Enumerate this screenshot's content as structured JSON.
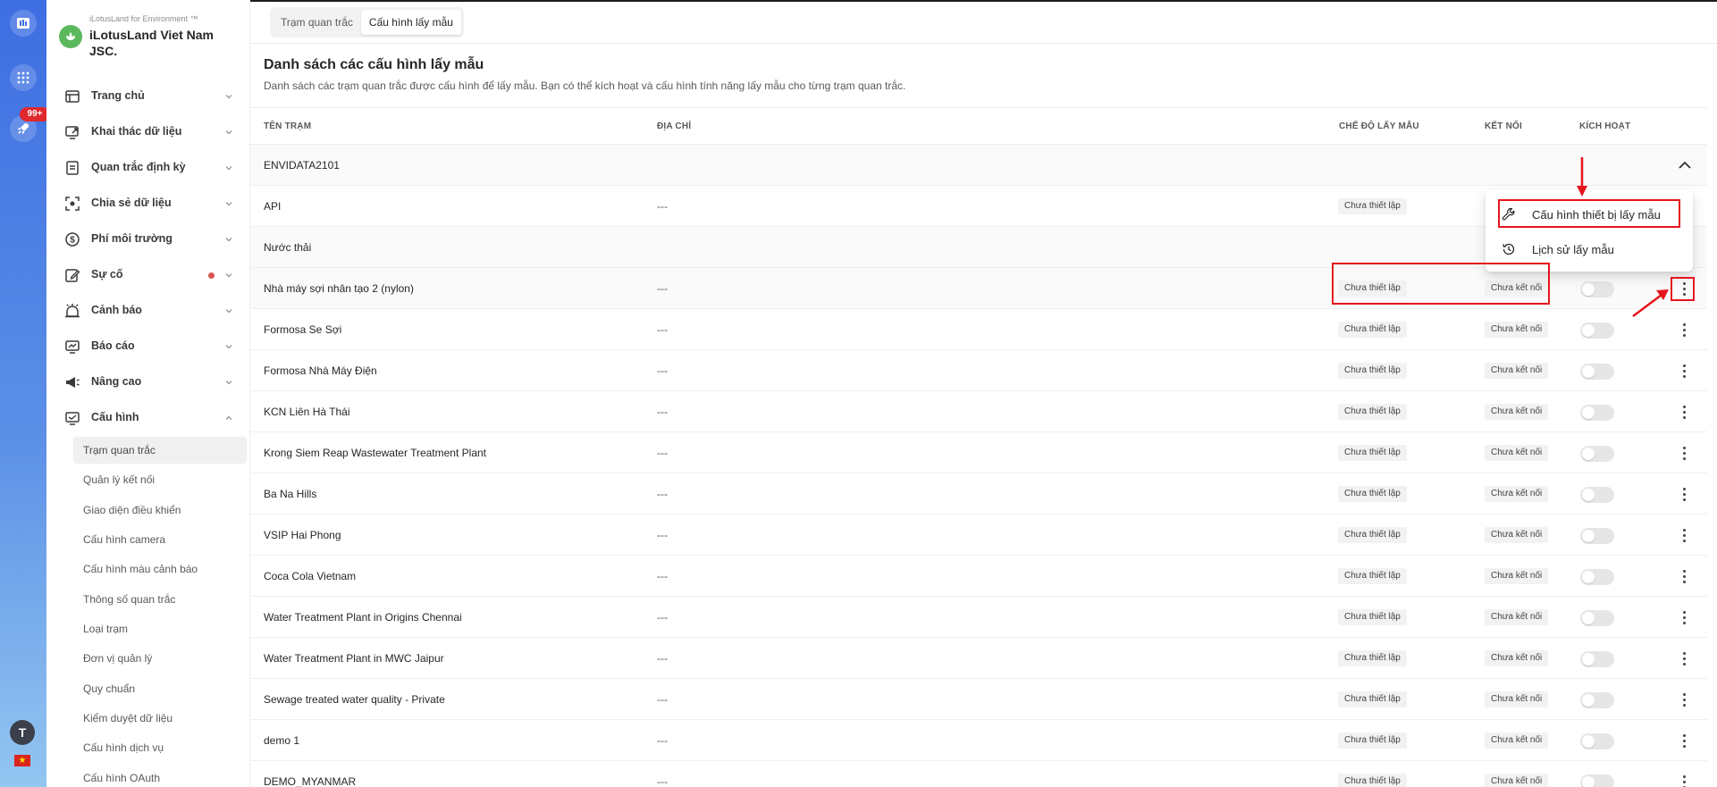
{
  "brand": {
    "subtitle": "iLotusLand for Environment ™",
    "name": "iLotusLand Viet Nam JSC."
  },
  "rail": {
    "notification_count": "99+",
    "user_initial": "T"
  },
  "nav": [
    {
      "label": "Trang chủ"
    },
    {
      "label": "Khai thác dữ liệu"
    },
    {
      "label": "Quan trắc định kỳ"
    },
    {
      "label": "Chia sẻ dữ liệu"
    },
    {
      "label": "Phí môi trường"
    },
    {
      "label": "Sự cố"
    },
    {
      "label": "Cảnh báo"
    },
    {
      "label": "Báo cáo"
    },
    {
      "label": "Nâng cao"
    },
    {
      "label": "Cấu hình"
    }
  ],
  "config_submenu": [
    "Trạm quan trắc",
    "Quản lý kết nối",
    "Giao diện điều khiển",
    "Cấu hình camera",
    "Cấu hình màu cảnh báo",
    "Thông số quan trắc",
    "Loại trạm",
    "Đơn vị quản lý",
    "Quy chuẩn",
    "Kiểm duyệt dữ liệu",
    "Cấu hình dịch vụ",
    "Cấu hình OAuth"
  ],
  "tabs": [
    "Trạm quan trắc",
    "Cấu hình lấy mẫu"
  ],
  "page": {
    "title": "Danh sách các cấu hình lấy mẫu",
    "description": "Danh sách các trạm quan trắc được cấu hình để lấy mẫu. Bạn có thể kích hoạt và cấu hình tính năng lấy mẫu cho từng trạm quan trắc."
  },
  "table": {
    "headers": {
      "name": "TÊN TRẠM",
      "address": "ĐỊA CHỈ",
      "mode": "CHẾ ĐỘ LẤY MẪU",
      "connection": "KẾT NỐI",
      "active": "KÍCH HOẠT"
    },
    "rows": [
      {
        "type": "group",
        "name": "ENVIDATA2101"
      },
      {
        "type": "station",
        "name": "API",
        "address": "---",
        "mode": "Chưa thiết lập"
      },
      {
        "type": "group",
        "name": "Nước thải"
      },
      {
        "type": "station",
        "name": "Nhà máy sợi nhân tạo 2 (nylon)",
        "address": "---",
        "mode": "Chưa thiết lập",
        "connection": "Chưa kết nối"
      },
      {
        "type": "station",
        "name": "Formosa Se Sợi",
        "address": "---",
        "mode": "Chưa thiết lập",
        "connection": "Chưa kết nối"
      },
      {
        "type": "station",
        "name": "Formosa Nhà Máy Điện",
        "address": "---",
        "mode": "Chưa thiết lập",
        "connection": "Chưa kết nối"
      },
      {
        "type": "station",
        "name": "KCN Liên Hà Thái",
        "address": "---",
        "mode": "Chưa thiết lập",
        "connection": "Chưa kết nối"
      },
      {
        "type": "station",
        "name": "Krong Siem Reap Wastewater Treatment Plant",
        "address": "---",
        "mode": "Chưa thiết lập",
        "connection": "Chưa kết nối"
      },
      {
        "type": "station",
        "name": "Ba Na Hills",
        "address": "---",
        "mode": "Chưa thiết lập",
        "connection": "Chưa kết nối"
      },
      {
        "type": "station",
        "name": "VSIP Hai Phong",
        "address": "---",
        "mode": "Chưa thiết lập",
        "connection": "Chưa kết nối"
      },
      {
        "type": "station",
        "name": "Coca Cola Vietnam",
        "address": "---",
        "mode": "Chưa thiết lập",
        "connection": "Chưa kết nối"
      },
      {
        "type": "station",
        "name": "Water Treatment Plant in Origins Chennai",
        "address": "---",
        "mode": "Chưa thiết lập",
        "connection": "Chưa kết nối"
      },
      {
        "type": "station",
        "name": "Water Treatment Plant in MWC Jaipur",
        "address": "---",
        "mode": "Chưa thiết lập",
        "connection": "Chưa kết nối"
      },
      {
        "type": "station",
        "name": "Sewage treated water quality - Private",
        "address": "---",
        "mode": "Chưa thiết lập",
        "connection": "Chưa kết nối"
      },
      {
        "type": "station",
        "name": "demo 1",
        "address": "---",
        "mode": "Chưa thiết lập",
        "connection": "Chưa kết nối"
      },
      {
        "type": "station",
        "name": "DEMO_MYANMAR",
        "address": "---",
        "mode": "Chưa thiết lập",
        "connection": "Chưa kết nối"
      }
    ]
  },
  "dropdown": {
    "items": [
      {
        "label": "Cấu hình thiết bị lấy mẫu",
        "icon": "wrench-icon"
      },
      {
        "label": "Lịch sử lấy mẫu",
        "icon": "clock-history-icon"
      }
    ]
  },
  "colors": {
    "annotation": "#e5141c",
    "rail_top": "#3e6ee2",
    "brand_green": "#5cb85c"
  }
}
